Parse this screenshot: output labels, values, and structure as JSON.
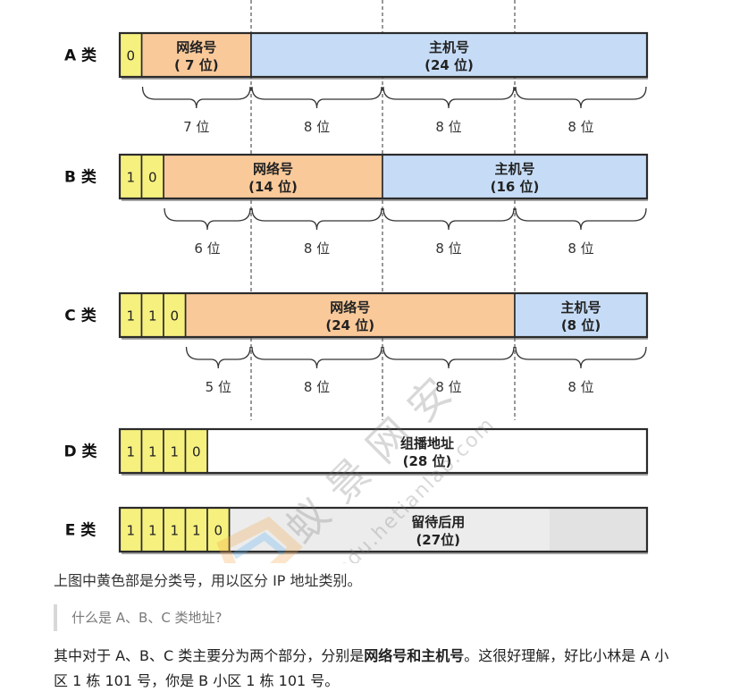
{
  "classes": [
    {
      "label": "A 类",
      "prefix": [
        "0"
      ],
      "segments": [
        {
          "role": "network",
          "title": "网络号",
          "sub": "( 7 位)"
        },
        {
          "role": "host",
          "title": "主机号",
          "sub": "(24 位)"
        }
      ],
      "brace_labels": [
        "7 位",
        "8 位",
        "8 位",
        "8 位"
      ]
    },
    {
      "label": "B 类",
      "prefix": [
        "1",
        "0"
      ],
      "segments": [
        {
          "role": "network",
          "title": "网络号",
          "sub": "(14 位)"
        },
        {
          "role": "host",
          "title": "主机号",
          "sub": "(16 位)"
        }
      ],
      "brace_labels": [
        "6 位",
        "8 位",
        "8 位",
        "8 位"
      ]
    },
    {
      "label": "C 类",
      "prefix": [
        "1",
        "1",
        "0"
      ],
      "segments": [
        {
          "role": "network",
          "title": "网络号",
          "sub": "(24 位)"
        },
        {
          "role": "host",
          "title": "主机号",
          "sub": "(8 位)"
        }
      ],
      "brace_labels": [
        "5 位",
        "8 位",
        "8 位",
        "8 位"
      ]
    },
    {
      "label": "D 类",
      "prefix": [
        "1",
        "1",
        "1",
        "0"
      ],
      "segments": [
        {
          "role": "multicast",
          "title": "组播地址",
          "sub": "(28 位)"
        }
      ],
      "brace_labels": []
    },
    {
      "label": "E 类",
      "prefix": [
        "1",
        "1",
        "1",
        "1",
        "0"
      ],
      "segments": [
        {
          "role": "reserved",
          "title": "留待后用",
          "sub": "(27位)"
        }
      ],
      "brace_labels": []
    }
  ],
  "colors": {
    "prefix": "#f6f07e",
    "network": "#f9c99a",
    "host": "#c6dcf6",
    "multicast": "#ffffff",
    "reserved": "#ececec",
    "border": "#2b2b2b"
  },
  "watermark": {
    "brand": "蚁景网安",
    "domain": "edu.hetianlab.com"
  },
  "text": {
    "caption": "上图中黄色部是分类号，用以区分 IP 地址类别。",
    "quote": "什么是 A、B、C 类地址?",
    "para_before": "其中对于 A、B、C 类主要分为两个部分，分别是",
    "para_bold": "网络号和主机号",
    "para_after": "。这很好理解，好比小林是 A 小区 1 栋 101 号，你是 B 小区 1 栋 101 号。"
  }
}
